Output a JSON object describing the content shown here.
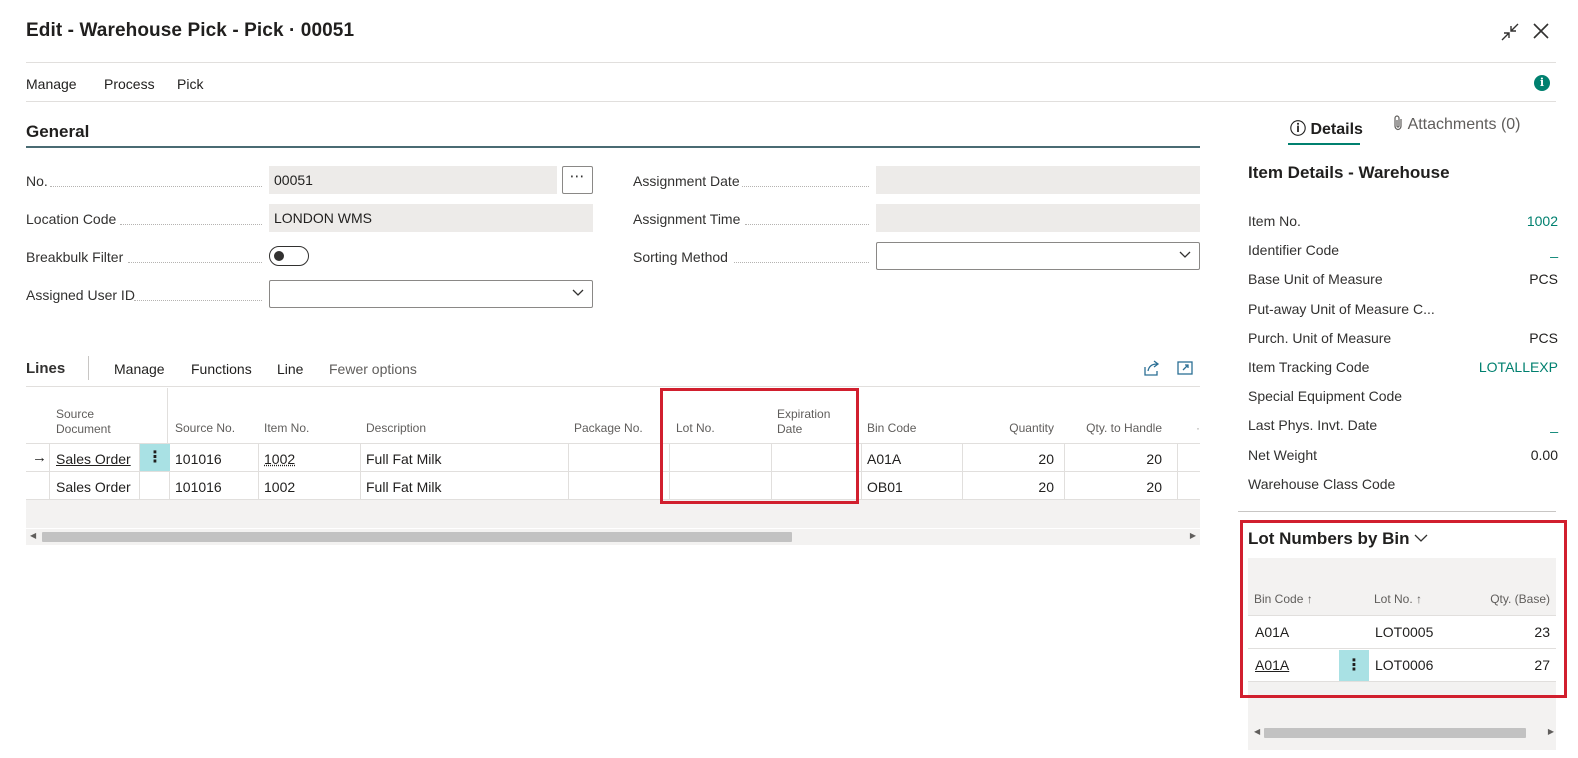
{
  "window": {
    "title": "Edit - Warehouse Pick - Pick · 00051"
  },
  "menu": [
    {
      "label": "Manage"
    },
    {
      "label": "Process"
    },
    {
      "label": "Pick"
    }
  ],
  "general": {
    "title": "General",
    "no_label": "No.",
    "no_value": "00051",
    "assist_glyph": "⋯",
    "location_label": "Location Code",
    "location_value": "LONDON WMS",
    "breakbulk_label": "Breakbulk Filter",
    "breakbulk_on": false,
    "assigned_user_label": "Assigned User ID",
    "assigned_user_value": "",
    "assignment_date_label": "Assignment Date",
    "assignment_date_value": "",
    "assignment_time_label": "Assignment Time",
    "assignment_time_value": "",
    "sorting_label": "Sorting Method",
    "sorting_value": ""
  },
  "lines": {
    "title": "Lines",
    "toolbar": [
      {
        "label": "Manage"
      },
      {
        "label": "Functions"
      },
      {
        "label": "Line"
      },
      {
        "label": "Fewer options"
      }
    ],
    "columns": {
      "source_document": "Source Document",
      "source_no": "Source No.",
      "item_no": "Item No.",
      "description": "Description",
      "package_no": "Package No.",
      "lot_no": "Lot No.",
      "expiration_date": "Expiration Date",
      "bin_code": "Bin Code",
      "quantity": "Quantity",
      "qty_to_handle": "Qty. to Handle"
    },
    "rows": [
      {
        "source_document": "Sales Order",
        "source_no": "101016",
        "item_no": "1002",
        "description": "Full Fat Milk",
        "package_no": "",
        "lot_no": "",
        "expiration_date": "",
        "bin_code": "A01A",
        "quantity": "20",
        "qty_to_handle": "20"
      },
      {
        "source_document": "Sales Order",
        "source_no": "101016",
        "item_no": "1002",
        "description": "Full Fat Milk",
        "package_no": "",
        "lot_no": "",
        "expiration_date": "",
        "bin_code": "OB01",
        "quantity": "20",
        "qty_to_handle": "20"
      }
    ],
    "active_row_glyph": "→",
    "kebab_glyph": "⋮"
  },
  "panel": {
    "tabs": [
      {
        "label": "Details",
        "active": true
      },
      {
        "label": "Attachments (0)",
        "active": false
      }
    ],
    "info_glyph": "ⓘ",
    "info_dot_glyph": "i",
    "item_details": {
      "title": "Item Details - Warehouse",
      "rows": [
        {
          "label": "Item No.",
          "value": "1002",
          "link": true
        },
        {
          "label": "Identifier Code",
          "value": "_",
          "link": true
        },
        {
          "label": "Base Unit of Measure",
          "value": "PCS",
          "link": false
        },
        {
          "label": "Put-away Unit of Measure C...",
          "value": "",
          "link": false
        },
        {
          "label": "Purch. Unit of Measure",
          "value": "PCS",
          "link": false
        },
        {
          "label": "Item Tracking Code",
          "value": "LOTALLEXP",
          "link": true
        },
        {
          "label": "Special Equipment Code",
          "value": "",
          "link": false
        },
        {
          "label": "Last Phys. Invt. Date",
          "value": "_",
          "link": true
        },
        {
          "label": "Net Weight",
          "value": "0.00",
          "link": false
        },
        {
          "label": "Warehouse Class Code",
          "value": "",
          "link": false
        }
      ]
    },
    "lot_by_bin": {
      "title": "Lot Numbers by Bin",
      "columns": {
        "bin_code": "Bin Code",
        "lot_no": "Lot No.",
        "qty_base": "Qty. (Base)"
      },
      "sort_glyph": "↑",
      "rows": [
        {
          "bin_code": "A01A",
          "lot_no": "LOT0005",
          "qty_base": "23"
        },
        {
          "bin_code": "A01A",
          "lot_no": "LOT0006",
          "qty_base": "27"
        }
      ]
    }
  },
  "colors": {
    "accent": "#00806f",
    "highlight_box": "#d11f2e",
    "kebab_bg": "#a9e1e4"
  }
}
